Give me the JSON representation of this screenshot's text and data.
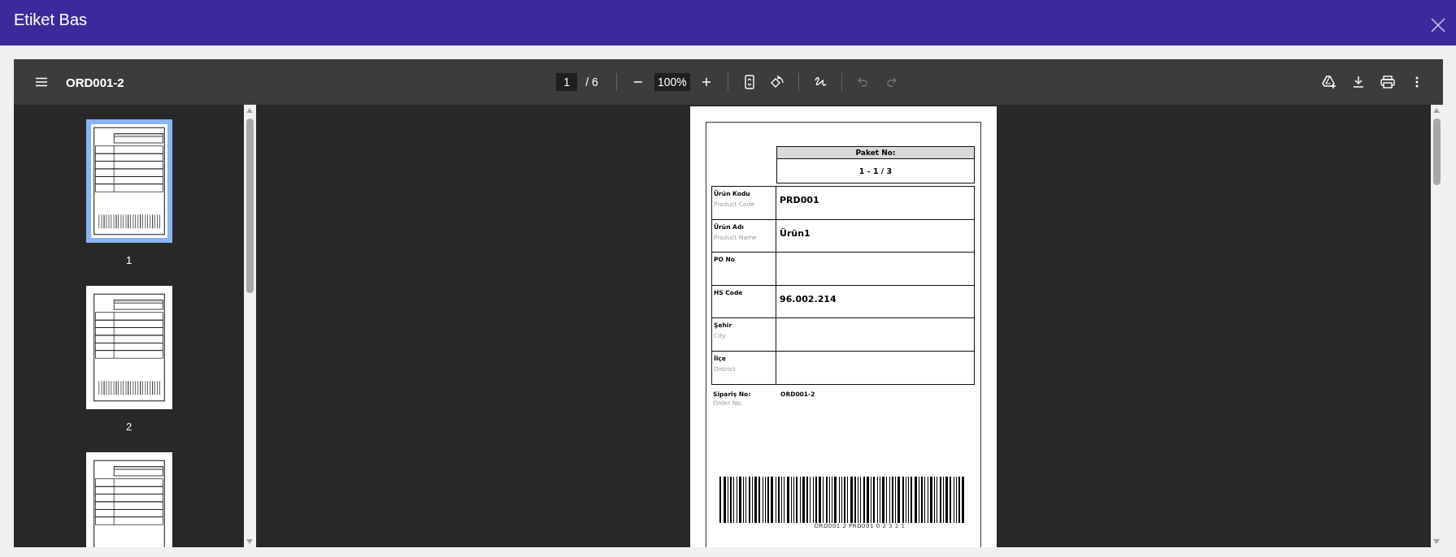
{
  "dialog": {
    "title": "Etiket Bas"
  },
  "viewer": {
    "document_title": "ORD001-2",
    "page_current": "1",
    "page_total": "/ 6",
    "zoom": "100%",
    "tools": [
      {
        "kind": "fit",
        "disabled": false
      },
      {
        "kind": "rotate",
        "disabled": false
      },
      {
        "kind": "draw",
        "disabled": false
      },
      {
        "kind": "undo",
        "disabled": true
      },
      {
        "kind": "redo",
        "disabled": true
      }
    ],
    "actions": [
      {
        "kind": "drive"
      },
      {
        "kind": "download"
      },
      {
        "kind": "print"
      },
      {
        "kind": "more"
      }
    ],
    "thumbnails": [
      {
        "label": "1",
        "selected": true
      },
      {
        "label": "2",
        "selected": false
      },
      {
        "selected": false
      }
    ]
  },
  "label": {
    "package_heading": "Paket No:",
    "package_value": "1 - 1 / 3",
    "rows": [
      {
        "label": "Ürün Kodu",
        "sublabel": "Product Code",
        "value": "PRD001"
      },
      {
        "label": "Ürün Adı",
        "sublabel": "Product Name",
        "value": "Ürün1"
      },
      {
        "label": "PO No"
      },
      {
        "label": "HS Code",
        "value": "96.002.214"
      },
      {
        "label": "Şehir",
        "sublabel": "City"
      },
      {
        "label": "İlçe",
        "sublabel": "District"
      }
    ],
    "order_label": "Sipariş No:",
    "order_sublabel": "Order No:",
    "order_value": "ORD001-2",
    "barcode_text": "ORD001 2 PRD001 0 2 3 1 1"
  }
}
